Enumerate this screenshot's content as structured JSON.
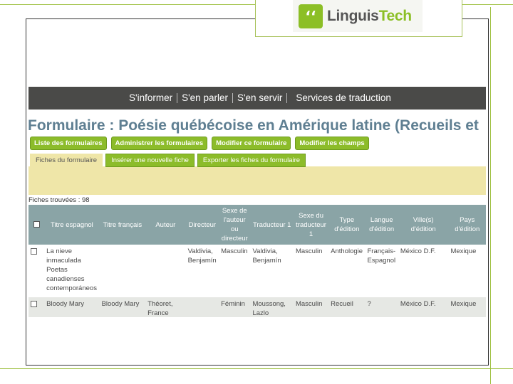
{
  "logo": {
    "brand_part1": "Linguis",
    "brand_part2": "Tech",
    "mark_glyph": "‘‘"
  },
  "nav": {
    "items": [
      "S'informer",
      "S'en parler",
      "S'en servir",
      "Services de traduction"
    ]
  },
  "page": {
    "title": "Formulaire : Poésie québécoise en Amérique latine (Recueils et",
    "buttons": [
      "Liste des formulaires",
      "Administrer les formulaires",
      "Modifier ce formulaire",
      "Modifier les champs"
    ],
    "tabs": [
      "Fiches du formulaire",
      "Insérer une nouvelle fiche",
      "Exporter les fiches du formulaire"
    ],
    "found_text": "Fiches trouvées : 98"
  },
  "table": {
    "headers": [
      "Titre espagnol",
      "Titre français",
      "Auteur",
      "Directeur",
      "Sexe de l'auteur ou directeur",
      "Traducteur 1",
      "Sexe du traducteur 1",
      "Type d'édition",
      "Langue d'édition",
      "Ville(s) d'édition",
      "Pays d'édition"
    ],
    "rows": [
      [
        "La nieve inmaculada Poetas canadienses contemporáneos",
        "",
        "",
        "Valdivia, Benjamín",
        "Masculin",
        "Valdivia, Benjamín",
        "Masculin",
        "Anthologie",
        "Français-Espagnol",
        "México D.F.",
        "Mexique"
      ],
      [
        "Bloody Mary",
        "Bloody Mary",
        "Théoret, France",
        "",
        "Féminin",
        "Moussong, Lazlo",
        "Masculin",
        "Recueil",
        "?",
        "México D.F.",
        "Mexique"
      ]
    ]
  },
  "colors": {
    "accent_green": "#8cbc2a",
    "nav_bg": "#4a4a48",
    "header_bg": "#8aa4a6",
    "tab_panel": "#efe6a8",
    "title_color": "#5f7f92"
  }
}
